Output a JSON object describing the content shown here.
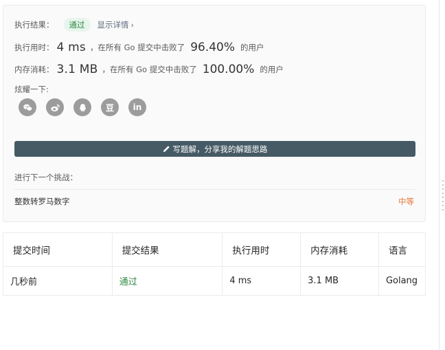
{
  "result": {
    "status_label": "执行结果：",
    "status_value": "通过",
    "detail_link": "显示详情",
    "runtime_label": "执行用时：",
    "runtime_value": "4 ms",
    "runtime_mid": "，在所有 Go 提交中击败了",
    "runtime_percent": "96.40%",
    "runtime_suffix": "的用户",
    "memory_label": "内存消耗：",
    "memory_value": "3.1 MB",
    "memory_mid": "，在所有 Go 提交中击败了",
    "memory_percent": "100.00%",
    "memory_suffix": "的用户",
    "share_label": "炫耀一下:",
    "share_icons": [
      "wechat-icon",
      "weibo-icon",
      "qq-icon",
      "douban-icon",
      "linkedin-icon"
    ],
    "douban_glyph": "豆",
    "linkedin_glyph": "in",
    "write_solution": "写题解，分享我的解题思路",
    "next_label": "进行下一个挑战：",
    "next_problem": "整数转罗马数字",
    "next_difficulty": "中等"
  },
  "table": {
    "headers": [
      "提交时间",
      "提交结果",
      "执行用时",
      "内存消耗",
      "语言"
    ],
    "rows": [
      [
        "几秒前",
        "通过",
        "4 ms",
        "3.1 MB",
        "Golang"
      ]
    ]
  },
  "colors": {
    "pass": "#2d8a43",
    "button_bg": "#455a64",
    "medium": "#e4793a"
  }
}
